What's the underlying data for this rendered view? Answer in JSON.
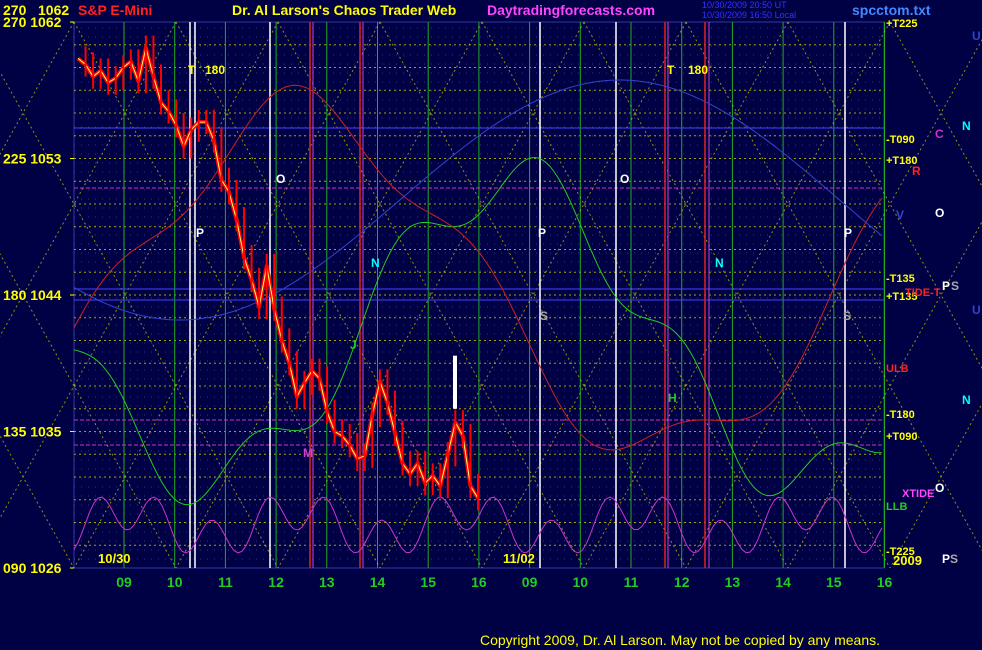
{
  "header": {
    "scale_left": "270",
    "scale_right": "1062",
    "symbol": "S&P E-Mini",
    "title": "Dr. Al Larson's Chaos Trader Web",
    "site": "Daytradingforecasts.com",
    "stamp1": "10/30/2009 20:50 UT",
    "stamp2": "10/30/2009 16:50 Local",
    "file": "spcctom.txt"
  },
  "footer": {
    "copyright": "Copyright 2009, Dr. Al Larson. May not be copied by any means."
  },
  "colors": {
    "background": "#000044",
    "grid": "#cccc00",
    "price_up": "#ff0000",
    "price_down": "#ff0000",
    "stamp": "#0000ff",
    "title": "#ffff00",
    "site": "#ff44ff",
    "green_line": "#22cc22",
    "red_line": "#cc2222",
    "magenta_line": "#cc33cc"
  },
  "chart_data": {
    "type": "line",
    "title": "S&P E-Mini",
    "y_axis_left": [
      {
        "label": "270 1062",
        "value": 1062
      },
      {
        "label": "225 1053",
        "value": 1053
      },
      {
        "label": "180 1044",
        "value": 1044
      },
      {
        "label": "135 1035",
        "value": 1035
      },
      {
        "label": "090 1026",
        "value": 1026
      }
    ],
    "ylim": [
      1026,
      1062
    ],
    "x_ticks": [
      "09",
      "10",
      "11",
      "12",
      "13",
      "14",
      "15",
      "16",
      "09",
      "10",
      "11",
      "12",
      "13",
      "14",
      "15",
      "16"
    ],
    "date_labels": [
      "10/30",
      "11/02",
      "2009"
    ],
    "price_series": {
      "name": "S&P E-Mini",
      "points": [
        [
          0,
          1059.6
        ],
        [
          1,
          1059.2
        ],
        [
          2,
          1058.4
        ],
        [
          3,
          1058.8
        ],
        [
          4,
          1058.0
        ],
        [
          5,
          1058.3
        ],
        [
          6,
          1059.0
        ],
        [
          7,
          1059.4
        ],
        [
          8,
          1058.1
        ],
        [
          9,
          1060.3
        ],
        [
          10,
          1058.4
        ],
        [
          11,
          1056.7
        ],
        [
          12,
          1056.1
        ],
        [
          13,
          1055.2
        ],
        [
          14,
          1053.8
        ],
        [
          15,
          1054.9
        ],
        [
          16,
          1055.4
        ],
        [
          17,
          1055.4
        ],
        [
          18,
          1054.2
        ],
        [
          19,
          1051.6
        ],
        [
          20,
          1050.8
        ],
        [
          21,
          1049.0
        ],
        [
          22,
          1046.5
        ],
        [
          23,
          1045.0
        ],
        [
          24,
          1043.2
        ],
        [
          25,
          1045.9
        ],
        [
          26,
          1043.1
        ],
        [
          27,
          1041.0
        ],
        [
          28,
          1039.5
        ],
        [
          29,
          1037.3
        ],
        [
          30,
          1038.2
        ],
        [
          31,
          1039.0
        ],
        [
          32,
          1038.5
        ],
        [
          33,
          1036.3
        ],
        [
          34,
          1035.0
        ],
        [
          35,
          1034.7
        ],
        [
          36,
          1034.1
        ],
        [
          37,
          1033.2
        ],
        [
          38,
          1033.4
        ],
        [
          39,
          1036.1
        ],
        [
          40,
          1038.3
        ],
        [
          41,
          1036.9
        ],
        [
          42,
          1034.9
        ],
        [
          43,
          1032.9
        ],
        [
          44,
          1032.2
        ],
        [
          45,
          1032.9
        ],
        [
          46,
          1031.6
        ],
        [
          47,
          1032.1
        ],
        [
          48,
          1031.4
        ],
        [
          49,
          1033.5
        ],
        [
          50,
          1035.6
        ],
        [
          51,
          1034.7
        ],
        [
          52,
          1031.4
        ],
        [
          53,
          1030.6
        ]
      ]
    },
    "overlay_labels": {
      "right_edge": [
        "+T225",
        "-T090",
        "+T180",
        "-T135",
        "+T135",
        "-T180",
        "+T090",
        "-T225",
        "ULB",
        "LLB",
        "XTIDE",
        "TIDE-T"
      ],
      "planets": [
        "T",
        "180",
        "O",
        "P",
        "S",
        "N",
        "J",
        "H",
        "M",
        "C",
        "R",
        "U",
        "V"
      ]
    }
  }
}
